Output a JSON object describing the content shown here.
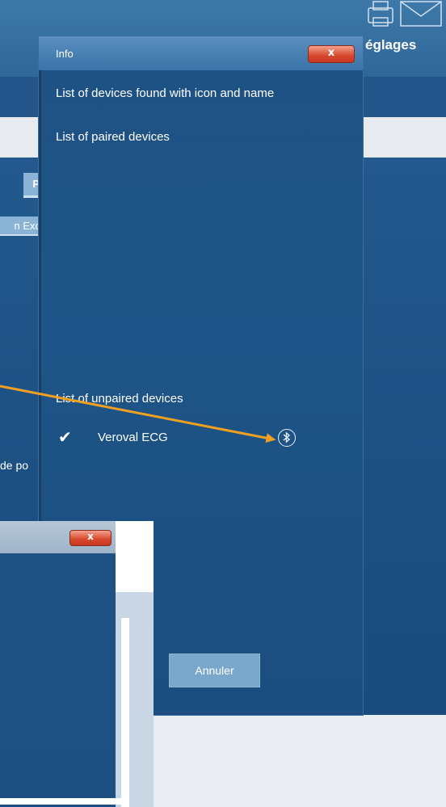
{
  "app": {
    "header_title": "églages",
    "left_button_p": "P",
    "left_button_exc": "n Exc",
    "left_text": "de po"
  },
  "dialog": {
    "title": "Info",
    "close_label": "x",
    "found_devices_label": "List of devices found with icon and name",
    "paired_label": "List of paired devices",
    "unpaired_label": "List of unpaired devices",
    "devices": [
      {
        "name": "Veroval ECG",
        "checked": true,
        "icon": "bluetooth-icon"
      }
    ],
    "cancel_label": "Annuler"
  },
  "dialog2": {
    "close_label": "x"
  },
  "colors": {
    "dialog_blue": "#1e5487",
    "close_red": "#d7472c",
    "arrow_orange": "#f0a020",
    "cancel_blue": "#7aa7cc"
  }
}
